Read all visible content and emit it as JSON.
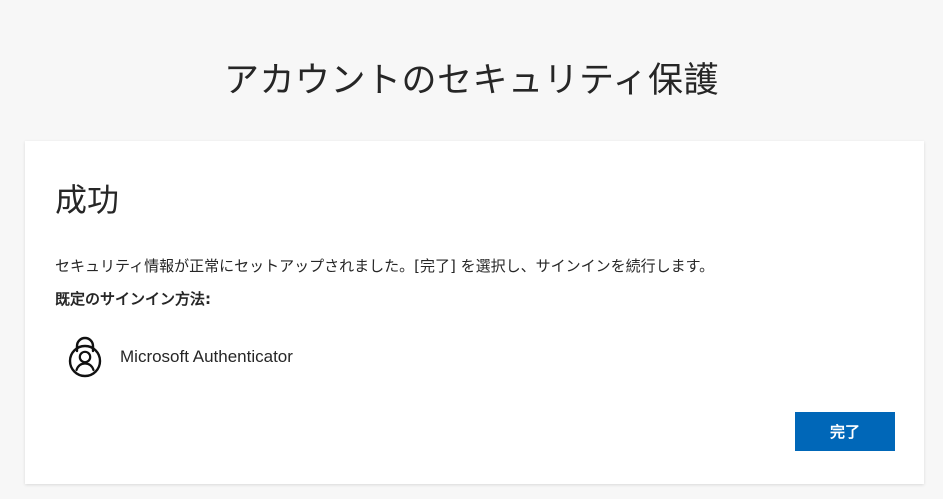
{
  "header": {
    "title": "アカウントのセキュリティ保護"
  },
  "card": {
    "title": "成功",
    "message": "セキュリティ情報が正常にセットアップされました。[完了] を選択し、サインインを続行します。",
    "default_method_label": "既定のサインイン方法:",
    "method": {
      "icon": "authenticator-lock-icon",
      "label": "Microsoft Authenticator"
    },
    "done_button_label": "完了"
  },
  "colors": {
    "accent": "#0067b8",
    "background": "#f7f7f7",
    "card": "#ffffff"
  }
}
